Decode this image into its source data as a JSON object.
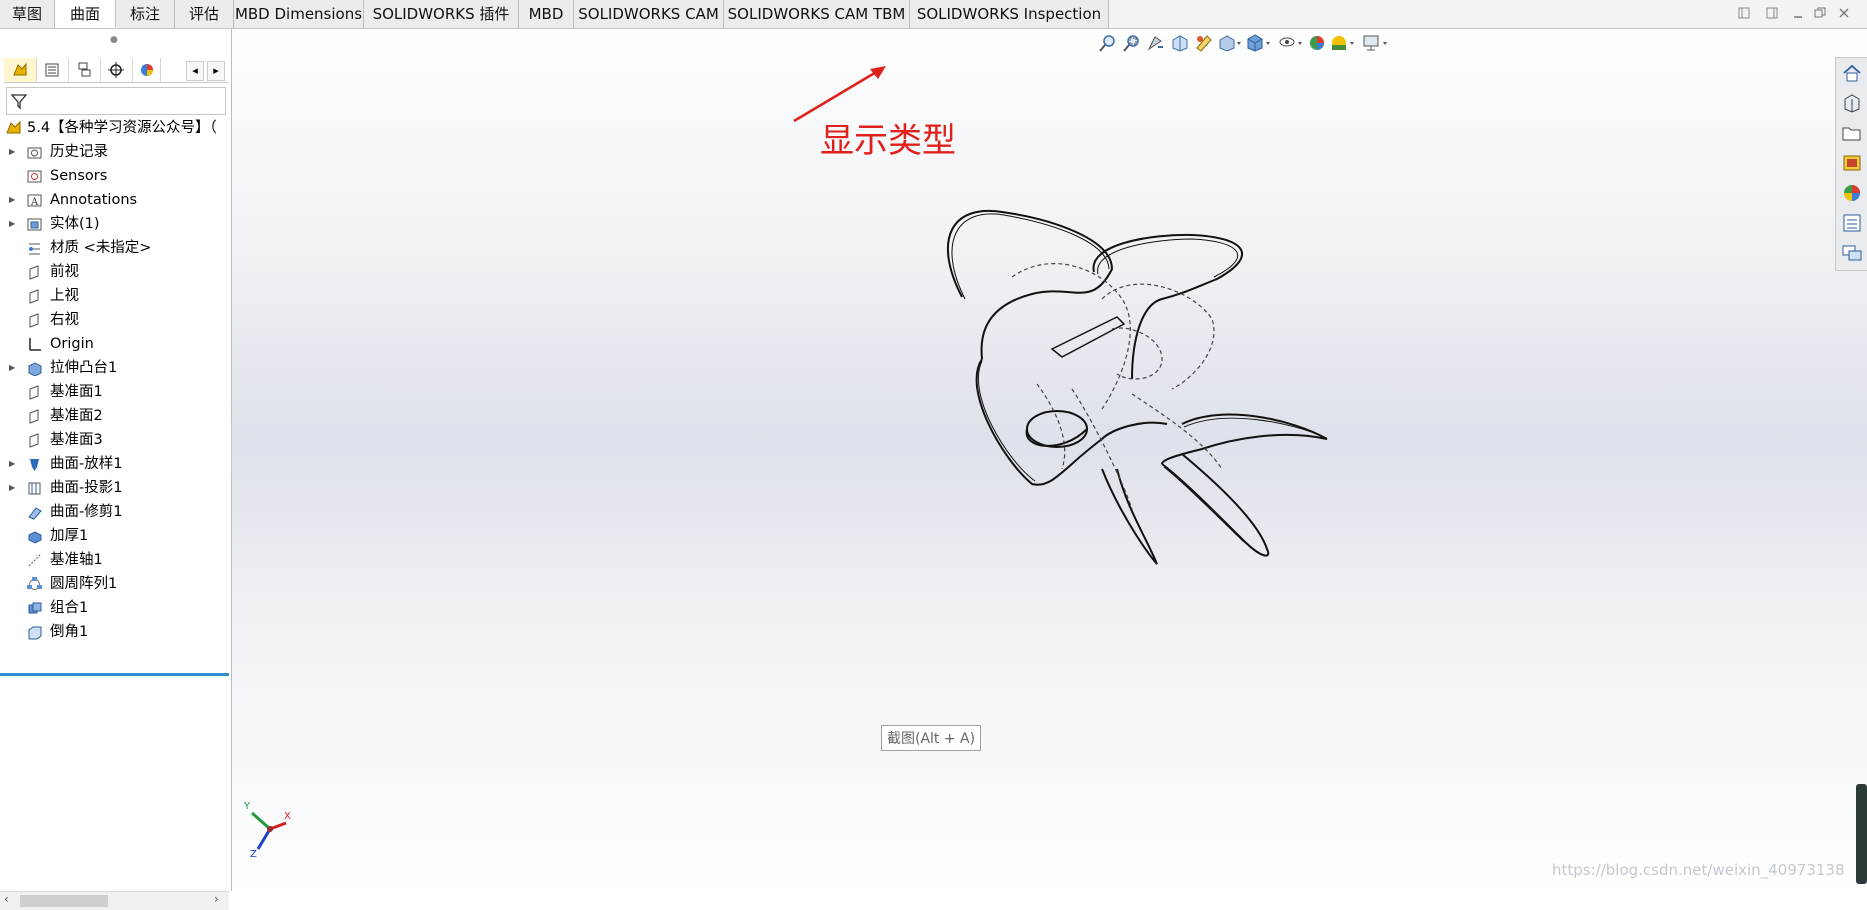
{
  "tabs": [
    {
      "label": "草图",
      "active": false
    },
    {
      "label": "曲面",
      "active": true
    },
    {
      "label": "标注",
      "active": false
    },
    {
      "label": "评估",
      "active": false
    },
    {
      "label": "MBD Dimensions",
      "active": false
    },
    {
      "label": "SOLIDWORKS 插件",
      "active": false
    },
    {
      "label": "MBD",
      "active": false
    },
    {
      "label": "SOLIDWORKS CAM",
      "active": false
    },
    {
      "label": "SOLIDWORKS CAM TBM",
      "active": false
    },
    {
      "label": "SOLIDWORKS Inspection",
      "active": false
    }
  ],
  "feature_tree": {
    "root_label": "5.4【各种学习资源公众号】（",
    "items": [
      {
        "label": "历史记录",
        "icon": "history-folder-icon",
        "expandable": true
      },
      {
        "label": "Sensors",
        "icon": "sensor-icon",
        "expandable": false
      },
      {
        "label": "Annotations",
        "icon": "annotation-icon",
        "expandable": true
      },
      {
        "label": "实体(1)",
        "icon": "solid-bodies-icon",
        "expandable": true
      },
      {
        "label": "材质 <未指定>",
        "icon": "material-icon",
        "expandable": false
      },
      {
        "label": "前视",
        "icon": "plane-icon",
        "expandable": false
      },
      {
        "label": "上视",
        "icon": "plane-icon",
        "expandable": false
      },
      {
        "label": "右视",
        "icon": "plane-icon",
        "expandable": false
      },
      {
        "label": "Origin",
        "icon": "origin-icon",
        "expandable": false
      },
      {
        "label": "拉伸凸台1",
        "icon": "extrude-icon",
        "expandable": true
      },
      {
        "label": "基准面1",
        "icon": "plane-icon",
        "expandable": false
      },
      {
        "label": "基准面2",
        "icon": "plane-icon",
        "expandable": false
      },
      {
        "label": "基准面3",
        "icon": "plane-icon",
        "expandable": false
      },
      {
        "label": "曲面-放样1",
        "icon": "surface-loft-icon",
        "expandable": true
      },
      {
        "label": "曲面-投影1",
        "icon": "surface-project-icon",
        "expandable": true
      },
      {
        "label": "曲面-修剪1",
        "icon": "surface-trim-icon",
        "expandable": false
      },
      {
        "label": "加厚1",
        "icon": "thicken-icon",
        "expandable": false
      },
      {
        "label": "基准轴1",
        "icon": "axis-icon",
        "expandable": false
      },
      {
        "label": "圆周阵列1",
        "icon": "circular-pattern-icon",
        "expandable": false
      },
      {
        "label": "组合1",
        "icon": "combine-icon",
        "expandable": false
      },
      {
        "label": "倒角1",
        "icon": "chamfer-icon",
        "expandable": false
      }
    ]
  },
  "annotation": {
    "callout_text": "显示类型",
    "color": "#e0201b"
  },
  "snip_tooltip": "截图(Alt + A)",
  "watermark": "https://blog.csdn.net/weixin_40973138",
  "triad": {
    "x": "X",
    "y": "Y",
    "z": "Z"
  },
  "colors": {
    "active_tab": "#ffffff",
    "tree_end_bar": "#2f8fd2",
    "callout": "#e0201b"
  }
}
